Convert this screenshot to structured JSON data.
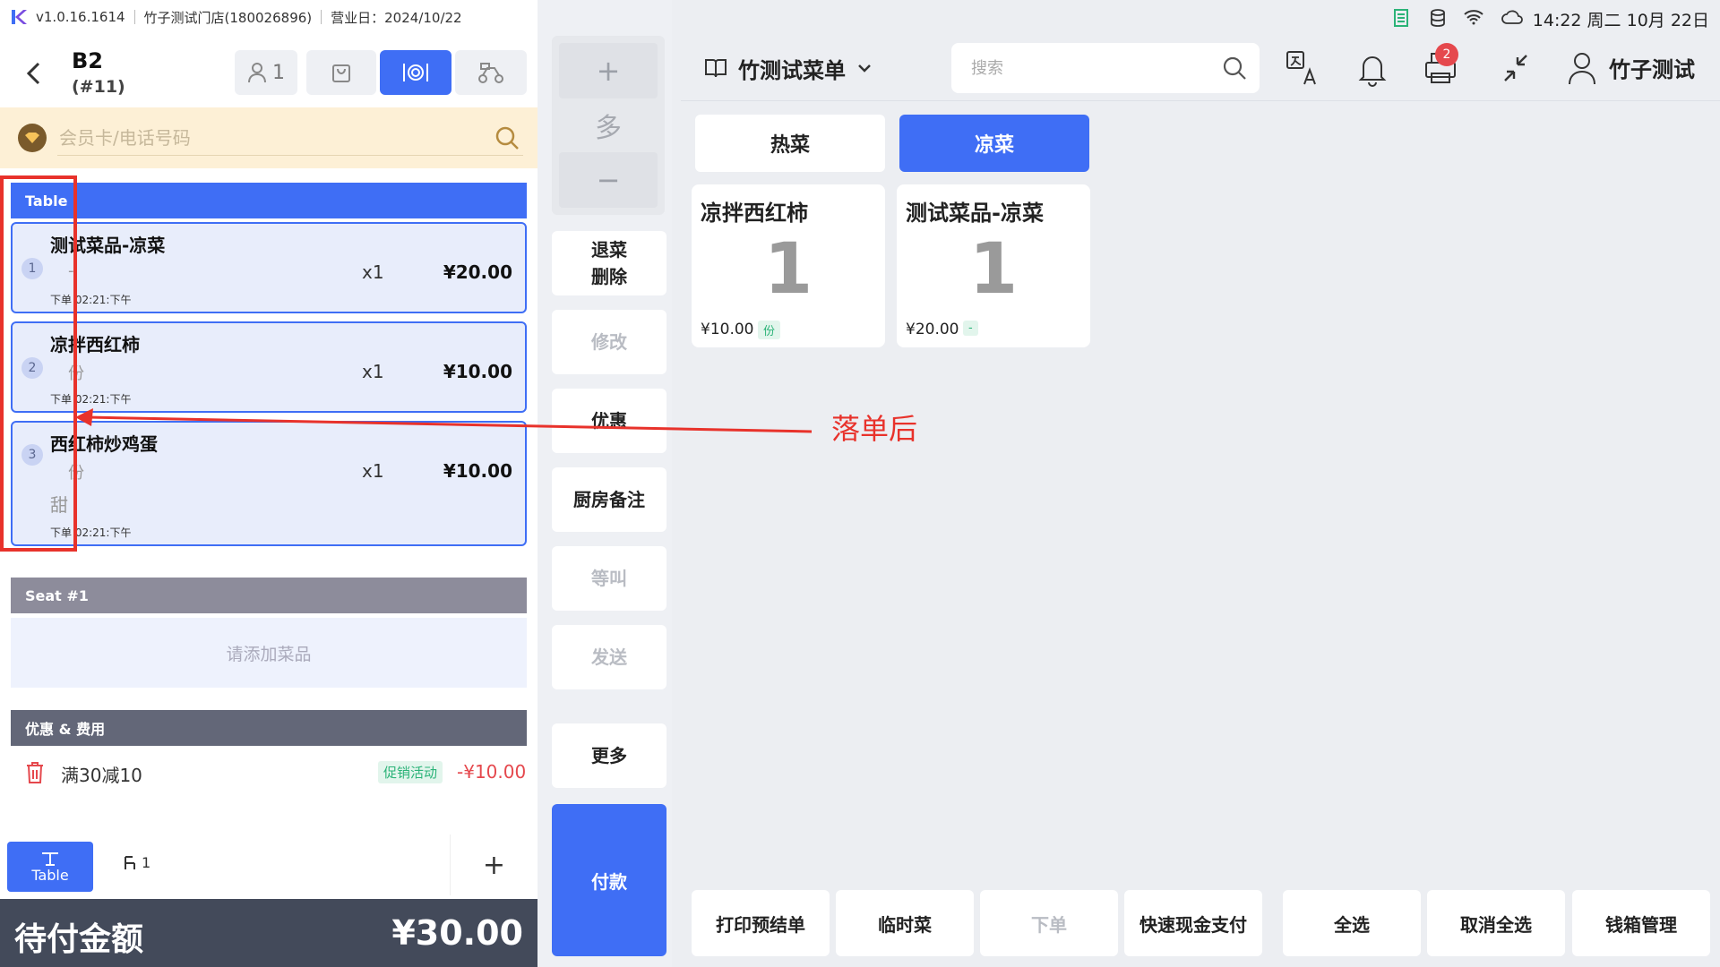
{
  "status_bar": {
    "version": "v1.0.16.1614",
    "store": "竹子测试门店(180026896)",
    "business_day": "营业日：2024/10/22"
  },
  "order": {
    "table_name": "B2",
    "order_no": "(#11)",
    "guests": "1"
  },
  "member": {
    "placeholder": "会员卡/电话号码"
  },
  "sections": {
    "table": "Table",
    "seat": "Seat #1",
    "discounts": "优惠 & 费用"
  },
  "items": [
    {
      "index": "1",
      "name": "测试菜品-凉菜",
      "unit": "-",
      "note": "",
      "qty": "x1",
      "price": "¥20.00",
      "time": "下单 02:21:下午"
    },
    {
      "index": "2",
      "name": "凉拌西红柿",
      "unit": "份",
      "note": "",
      "qty": "x1",
      "price": "¥10.00",
      "time": "下单 02:21:下午"
    },
    {
      "index": "3",
      "name": "西红柿炒鸡蛋",
      "unit": "份",
      "note": "甜",
      "qty": "x1",
      "price": "¥10.00",
      "time": "下单 02:21:下午"
    }
  ],
  "seat_empty": "请添加菜品",
  "discount": {
    "name": "满30减10",
    "tag": "促销活动",
    "amount": "-¥10.00"
  },
  "seat_tabs": {
    "table": "Table",
    "seat": "1",
    "add": "+"
  },
  "total": {
    "label": "待付金额",
    "amount": "¥30.00"
  },
  "actions": {
    "plus": "+",
    "multi": "多",
    "minus": "−",
    "refund": "退菜",
    "delete": "删除",
    "modify": "修改",
    "promo": "优惠",
    "kitchen_note": "厨房备注",
    "wait_call": "等叫",
    "send": "发送",
    "more": "更多",
    "pay": "付款"
  },
  "top": {
    "menu_name": "竹测试菜单",
    "search_placeholder": "搜索",
    "notification_count": "2",
    "user": "竹子测试",
    "clock": "14:22 周二 10月 22日"
  },
  "categories": [
    {
      "label": "热菜"
    },
    {
      "label": "凉菜"
    }
  ],
  "dishes": [
    {
      "name": "凉拌西红柿",
      "count": "1",
      "price": "¥10.00",
      "unit": "份"
    },
    {
      "name": "测试菜品-凉菜",
      "count": "1",
      "price": "¥20.00",
      "unit": "-"
    }
  ],
  "annotation": "落单后",
  "bottom_buttons": [
    {
      "label": "打印预结单"
    },
    {
      "label": "临时菜"
    },
    {
      "label": "下单"
    },
    {
      "label": "快速现金支付"
    },
    {
      "label": "全选"
    },
    {
      "label": "取消全选"
    },
    {
      "label": "钱箱管理"
    }
  ],
  "colors": {
    "primary": "#3f6ef5",
    "annotation_red": "#e8322b",
    "member_bg": "#fdf0d6",
    "total_bar": "#434a5a"
  }
}
